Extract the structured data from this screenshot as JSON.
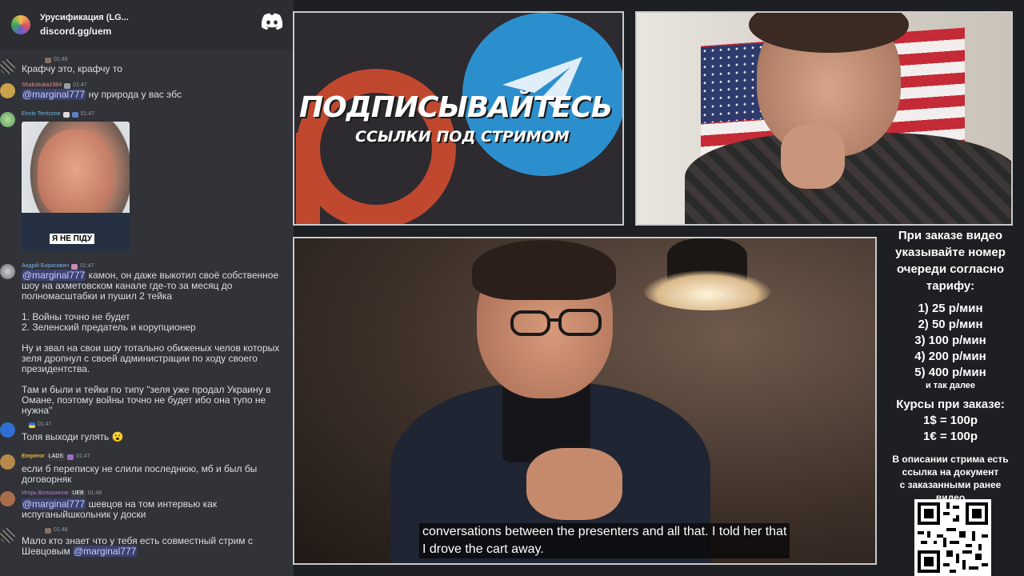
{
  "server": {
    "name": "Урусификация (LG...",
    "invite": "discord.gg/uem"
  },
  "chat": {
    "messages": [
      {
        "user": "",
        "time": "01:46",
        "text": "Крафчу это, крафчу то",
        "avatar_color": "#6b6b6b"
      },
      {
        "user": "Shakshuka1984",
        "time": "01:47",
        "mention": "@marginal777",
        "text": "ну природа у вас эбс",
        "user_color": "#e88a8a",
        "avatar_color": "#c9a24b"
      },
      {
        "user": "Ennio Terricone",
        "time": "01:47",
        "user_color": "#6fb6e6",
        "avatar_color": "#5aa05a",
        "meme_caption": "Я НЕ ПІДУ"
      },
      {
        "user": "Андрій Борисович",
        "time": "01:47",
        "user_color": "#7fb3e8",
        "avatar_color": "#8c8c8c",
        "mention": "@marginal777",
        "text": "камон, он даже выкотил своё собственное шоу на ахметовском канале где-то за месяц до полномасштабки и пушил 2 тейка",
        "list1": "1. Войны точно не будет",
        "list2": "2. Зеленский предатель и корупционер",
        "para2": "Ну и звал на свои шоу тотально обиженых челов которых зеля дропнул с своей администрации по ходу своего президентства.",
        "para3": "Там и были и тейки по типу \"зеля уже продал Украину в Омане, поэтому войны точно не будет ибо она тупо не нужна\""
      },
      {
        "user": "",
        "time": "01:47",
        "text": "Толя выходи гулять",
        "emoji": "😮",
        "avatar_color": "#2f6fd1"
      },
      {
        "user": "Emperor",
        "badge_text": "LADS",
        "time": "01:47",
        "text": "если б переписку не слили последнюю, мб и был бы договорняк",
        "user_color": "#f0b232",
        "avatar_color": "#b78a4a"
      },
      {
        "user": "Игорь Волошинов",
        "badge_text": "UEB",
        "time": "01:48",
        "mention": "@marginal777",
        "text": "шевцов на том интервью как испуганыйшкольник у доски",
        "user_color": "#b07fd8",
        "avatar_color": "#a86e4c"
      },
      {
        "user": "",
        "time": "01:48",
        "text": "Мало кто знает что у тебя есть совместный стрим с Шевцовым",
        "mention": "@marginal777",
        "avatar_color": "#555555"
      }
    ]
  },
  "promo": {
    "title": "ПОДПИСЫВАЙТЕСЬ",
    "subtitle": "ССЫЛКИ ПОД СТРИМОМ"
  },
  "video": {
    "subtitle_line1": "conversations between the presenters and all that. I told her that",
    "subtitle_line2": "I drove the cart away."
  },
  "info": {
    "head": [
      "При заказе видео",
      "указывайте номер",
      "очереди согласно",
      "тарифу:"
    ],
    "tariffs": [
      "1) 25 р/мин",
      "2) 50 р/мин",
      "3) 100 р/мин",
      "4) 200 р/мин",
      "5) 400 р/мин"
    ],
    "more": "и так далее",
    "rates_title": "Курсы при заказе:",
    "rates": [
      "1$ = 100р",
      "1€ = 100р"
    ],
    "desc": [
      "В описании стрима есть",
      "ссылка на документ",
      "с заказанными ранее",
      "видео"
    ]
  },
  "colors": {
    "chat_bg": "#313338",
    "mention_bg": "#3c4270",
    "discord_blurple": "#ffffff"
  }
}
